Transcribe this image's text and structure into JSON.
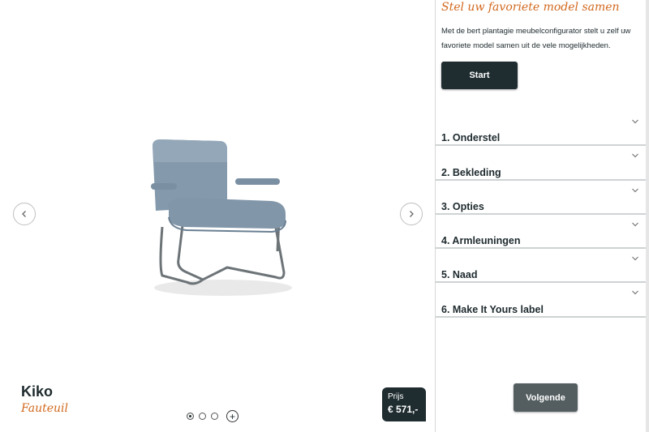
{
  "viewer": {
    "product_name": "Kiko",
    "product_type": "Fauteuil",
    "price_label": "Prijs",
    "price_value": "€ 571,-",
    "gallery": {
      "total_images": 3,
      "active_index": 0
    },
    "icons": {
      "prev": "chevron-left-icon",
      "next": "chevron-right-icon",
      "add": "plus-icon"
    }
  },
  "panel": {
    "title": "Stel uw favoriete model samen",
    "intro": "Met de bert plantagie meubelconfigurator stelt u zelf uw favoriete model samen uit de vele mogelijkheden.",
    "start_label": "Start",
    "sections": [
      {
        "label": "1. Onderstel"
      },
      {
        "label": "2. Bekleding"
      },
      {
        "label": "3. Opties"
      },
      {
        "label": "4. Armleuningen"
      },
      {
        "label": "5. Naad"
      },
      {
        "label": "6. Make It Yours label"
      }
    ],
    "next_label": "Volgende"
  },
  "colors": {
    "accent": "#d2691e",
    "dark_button": "#1f2d31",
    "secondary_button": "#545e60",
    "chair_fabric": "#7f95a8",
    "chair_frame": "#6d7478"
  }
}
